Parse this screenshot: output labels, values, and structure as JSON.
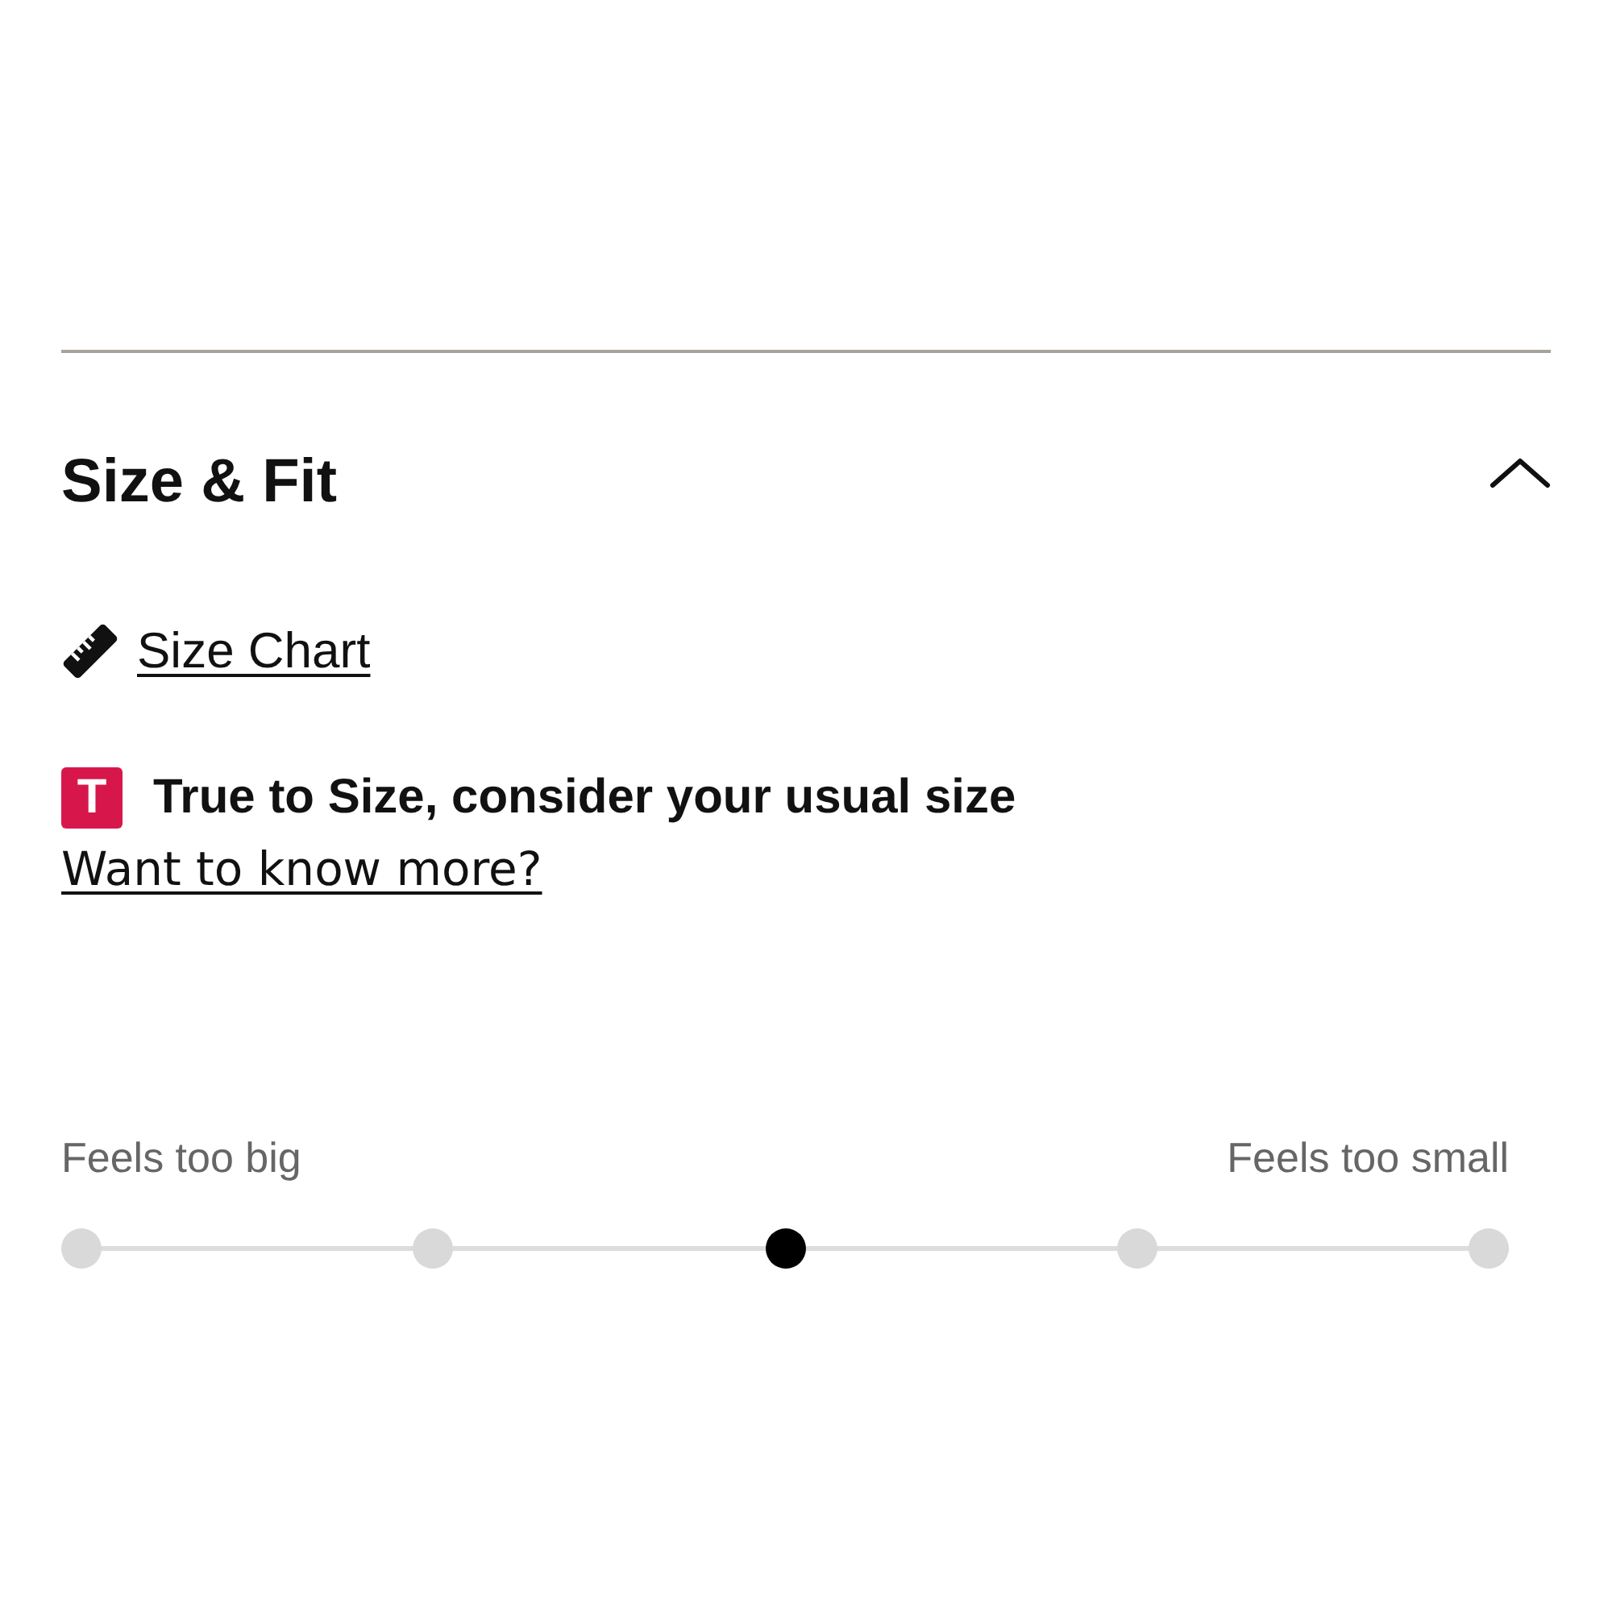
{
  "section": {
    "title": "Size & Fit",
    "expanded": true
  },
  "size_chart": {
    "link": "Size Chart"
  },
  "fit_summary": {
    "badge": "T",
    "text": "True to Size, consider your usual size",
    "link": "Want to know more?"
  },
  "fit_scale": {
    "left_label": "Feels too big",
    "right_label": "Feels too small",
    "points": [
      {
        "selected": false
      },
      {
        "selected": false
      },
      {
        "selected": true
      },
      {
        "selected": false
      },
      {
        "selected": false
      }
    ]
  }
}
